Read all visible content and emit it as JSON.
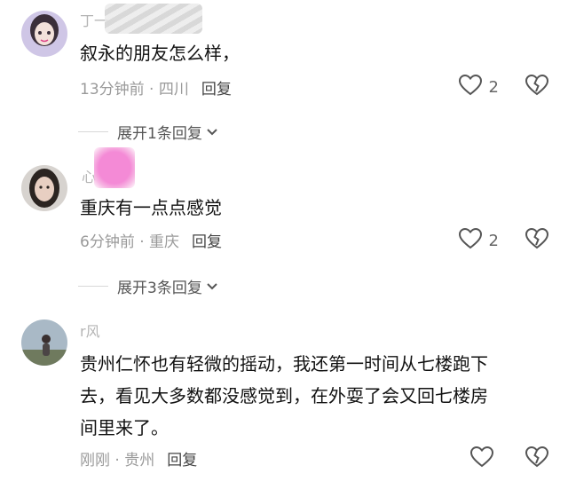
{
  "comments": [
    {
      "username": "丁一",
      "text": "叙永的朋友怎么样，",
      "time": "13分钟前",
      "location": "四川",
      "reply_label": "回复",
      "likes": "2",
      "expand_label": "展开1条回复"
    },
    {
      "username": "心",
      "text": "重庆有一点点感觉",
      "time": "6分钟前",
      "location": "重庆",
      "reply_label": "回复",
      "likes": "2",
      "expand_label": "展开3条回复"
    },
    {
      "username": "r风",
      "text_lines": [
        "贵州仁怀也有轻微的摇动，我还第一时间从七楼跑下",
        "去，看见大多数都没感觉到，在外耍了会又回七楼房",
        "间里来了。"
      ],
      "time": "刚刚",
      "location": "贵州",
      "reply_label": "回复",
      "likes": ""
    }
  ],
  "icons": {
    "heart": "heart-outline-icon",
    "broken_heart": "broken-heart-icon",
    "chevron": "chevron-down-icon"
  },
  "colors": {
    "meta": "#9a9a9a",
    "text": "#111111",
    "redact_pink": "#f27bd0"
  }
}
